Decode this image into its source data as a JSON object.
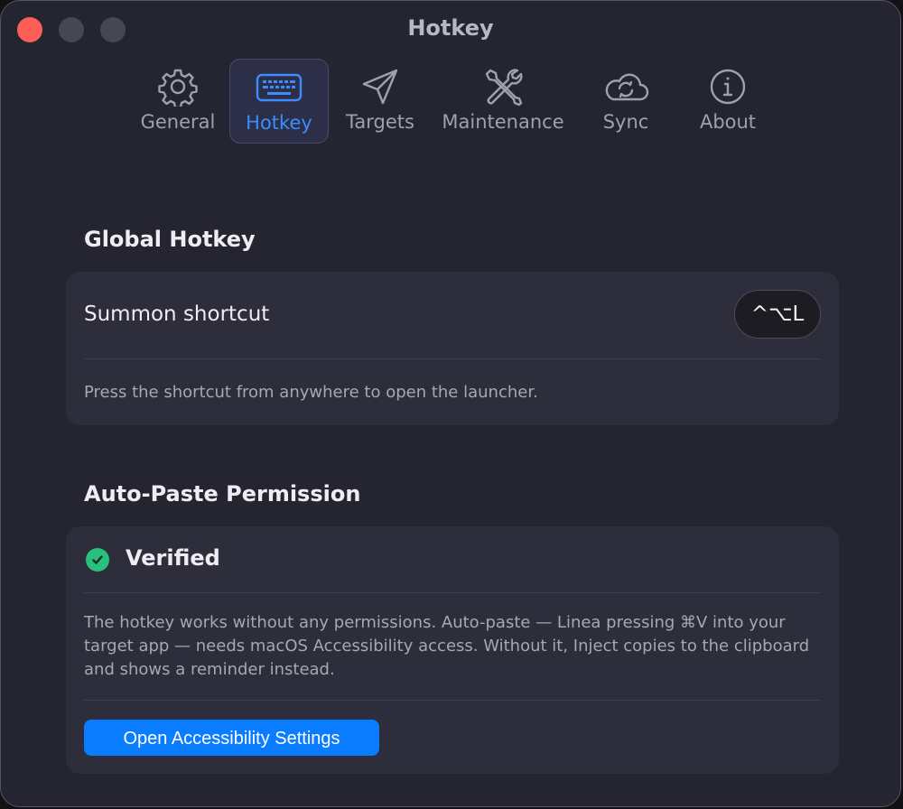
{
  "window": {
    "title": "Hotkey"
  },
  "tabs": [
    {
      "label": "General",
      "icon": "gear-icon"
    },
    {
      "label": "Hotkey",
      "icon": "keyboard-icon",
      "active": true
    },
    {
      "label": "Targets",
      "icon": "paper-plane-icon"
    },
    {
      "label": "Maintenance",
      "icon": "tools-icon"
    },
    {
      "label": "Sync",
      "icon": "cloud-sync-icon"
    },
    {
      "label": "About",
      "icon": "info-icon"
    }
  ],
  "global_hotkey": {
    "title": "Global Hotkey",
    "summon_label": "Summon shortcut",
    "shortcut_value": "^⌥L",
    "help": "Press the shortcut from anywhere to open the launcher."
  },
  "auto_paste": {
    "title": "Auto-Paste Permission",
    "status": "Verified",
    "description": "The hotkey works without any permissions. Auto-paste — Linea pressing ⌘V into your target app — needs macOS Accessibility access. Without it, Inject copies to the clipboard and shows a reminder instead.",
    "button_label": "Open Accessibility Settings"
  },
  "colors": {
    "accent": "#0a7cff",
    "active_tab": "#3b8cff",
    "verified": "#27c07d",
    "close": "#fd5f57"
  }
}
